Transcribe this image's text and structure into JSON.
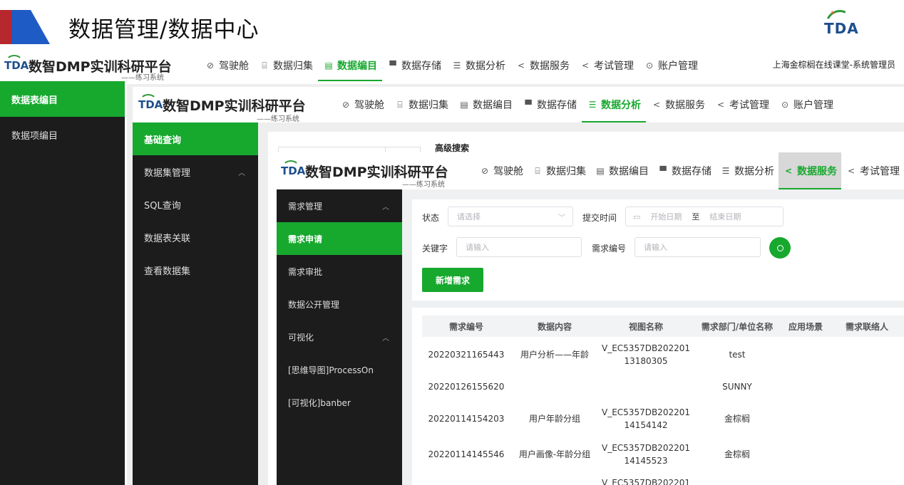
{
  "slide": {
    "title": "数据管理/数据中心",
    "logo_text": "TDA"
  },
  "brand": {
    "logo": "TDA",
    "name": "数智DMP实训科研平台",
    "sub": "——练习系统"
  },
  "nav": {
    "items": [
      "驾驶舱",
      "数据归集",
      "数据编目",
      "数据存储",
      "数据分析",
      "数据服务",
      "考试管理",
      "账户管理"
    ],
    "icons": [
      "gauge-icon",
      "inbox-icon",
      "catalog-icon",
      "monitor-icon",
      "sliders-icon",
      "share-icon",
      "share-icon",
      "account-icon"
    ],
    "glyphs": [
      "⊘",
      "⌸",
      "▤",
      "▀",
      "☰",
      "<",
      "<",
      "⊙"
    ]
  },
  "nav1": {
    "active": "数据编目",
    "user": "上海金棕榈在线课堂-系统管理员"
  },
  "nav2": {
    "active": "数据分析"
  },
  "nav3": {
    "active": "数据服务",
    "visible_items": [
      "驾驶舱",
      "数据归集",
      "数据编目",
      "数据存储",
      "数据分析",
      "数据服务",
      "考试管理"
    ]
  },
  "sidebar1": {
    "items": [
      "数据表编目",
      "数据项编目"
    ]
  },
  "sidebar2": {
    "items": [
      "基础查询",
      "数据集管理",
      "SQL查询",
      "数据表关联",
      "查看数据集"
    ]
  },
  "sidebar3": {
    "items": [
      "需求管理",
      "需求申请",
      "需求审批",
      "数据公开管理",
      "可视化",
      "[思维导图]ProcessOn",
      "[可视化]banber"
    ]
  },
  "adv_search": "高级搜索",
  "filters": {
    "status_label": "状态",
    "status_placeholder": "请选择",
    "time_label": "提交时间",
    "start_placeholder": "开始日期",
    "to": "至",
    "end_placeholder": "结束日期",
    "keyword_label": "关键字",
    "keyword_placeholder": "请输入",
    "reqno_label": "需求编号",
    "reqno_placeholder": "请输入",
    "add_button": "新增需求"
  },
  "table": {
    "headers": [
      "需求编号",
      "数据内容",
      "视图名称",
      "需求部门/单位名称",
      "应用场景",
      "需求联络人"
    ],
    "rows": [
      {
        "id": "20220321165443",
        "content": "用户分析——年龄",
        "view1": "V_EC5357DB202201",
        "view2": "13180305",
        "dept": "test"
      },
      {
        "id": "20220126155620",
        "content": "",
        "view1": "",
        "view2": "",
        "dept": "SUNNY"
      },
      {
        "id": "20220114154203",
        "content": "用户年龄分组",
        "view1": "V_EC5357DB202201",
        "view2": "14154142",
        "dept": "金棕榈"
      },
      {
        "id": "20220114145546",
        "content": "用户画像-年龄分组",
        "view1": "V_EC5357DB202201",
        "view2": "14145523",
        "dept": "金棕榈"
      },
      {
        "id": "",
        "content": "",
        "view1": "V_EC5357DB202201",
        "view2": "",
        "dept": ""
      }
    ]
  },
  "colors": {
    "accent": "#17a82e",
    "sidebar": "#1c1c1c",
    "brand_blue": "#1e4f8f"
  }
}
